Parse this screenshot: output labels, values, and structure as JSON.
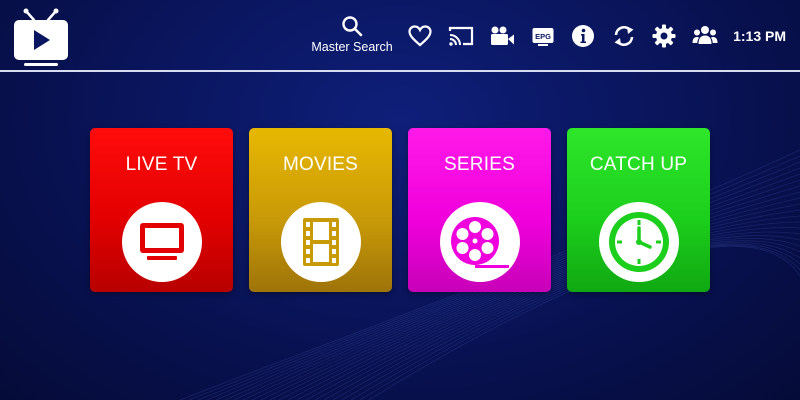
{
  "topbar": {
    "search_label": "Master Search",
    "time": "1:13 PM",
    "icons": [
      "favorites-heart-icon",
      "cast-icon",
      "video-camera-icon",
      "epg-icon",
      "info-icon",
      "refresh-icon",
      "settings-gear-icon",
      "users-icon"
    ],
    "epg_text": "EPG"
  },
  "tiles": [
    {
      "label": "LIVE TV",
      "icon": "tv-icon",
      "color": "#e30000"
    },
    {
      "label": "MOVIES",
      "icon": "film-strip-icon",
      "color": "#c99a08"
    },
    {
      "label": "SERIES",
      "icon": "film-reel-icon",
      "color": "#f000dc"
    },
    {
      "label": "CATCH UP",
      "icon": "clock-icon",
      "color": "#1ccf1c"
    }
  ],
  "colors": {
    "background": "#0a1660",
    "divider": "#d8dcf0"
  }
}
